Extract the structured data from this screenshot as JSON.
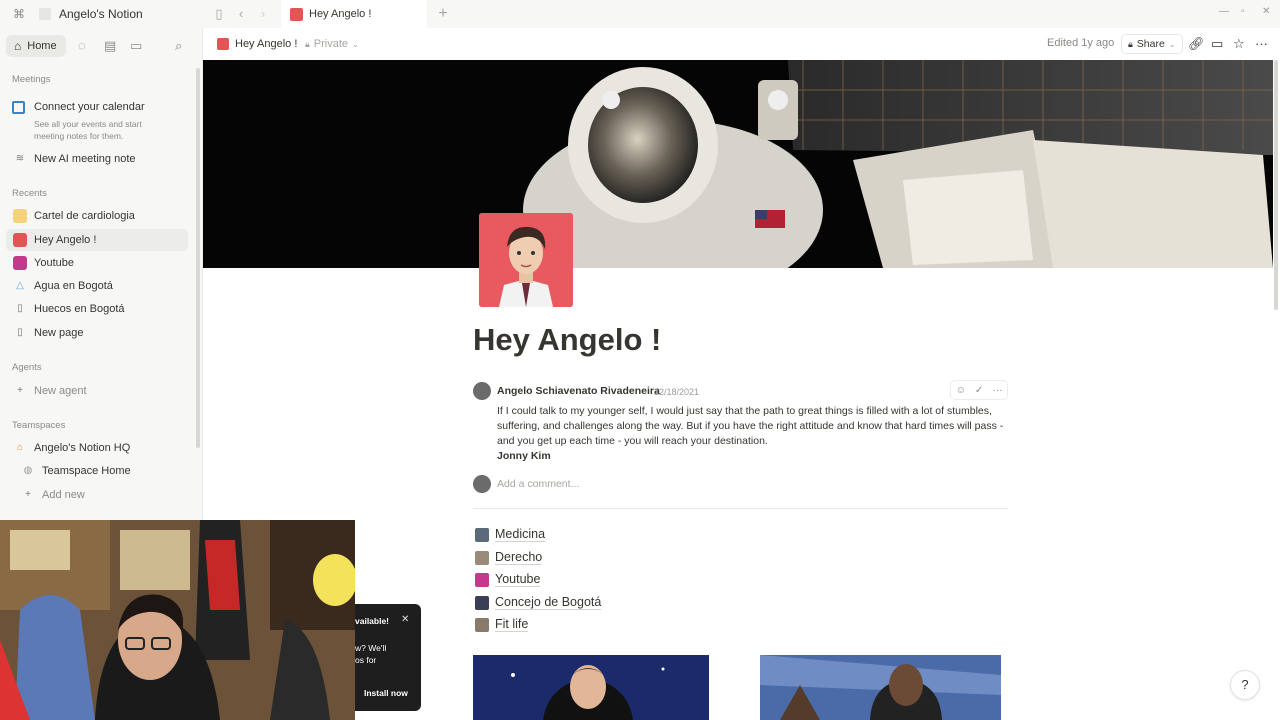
{
  "app": {
    "workspace_name": "Angelo's Notion",
    "tab_title": "Hey Angelo !"
  },
  "sidebar": {
    "home_label": "Home",
    "meetings_label": "Meetings",
    "calendar_title": "Connect your calendar",
    "calendar_desc": "See all your events and start meeting notes for them.",
    "ai_meeting": "New AI meeting note",
    "recents_label": "Recents",
    "recents": [
      {
        "label": "Cartel de cardiologia"
      },
      {
        "label": "Hey Angelo !"
      },
      {
        "label": "Youtube"
      },
      {
        "label": "Agua en Bogotá"
      },
      {
        "label": "Huecos en Bogotá"
      },
      {
        "label": "New page"
      }
    ],
    "agents_label": "Agents",
    "new_agent": "New agent",
    "teamspaces_label": "Teamspaces",
    "teamspace_name": "Angelo's Notion HQ",
    "teamspace_home": "Teamspace Home",
    "add_new": "Add new"
  },
  "topbar": {
    "breadcrumb": "Hey Angelo !",
    "privacy": "Private",
    "edited": "Edited 1y ago",
    "share": "Share"
  },
  "page": {
    "title": "Hey Angelo !",
    "comment": {
      "author": "Angelo Schiavenato Rivadeneira",
      "date": "12/18/2021",
      "body": "If I could talk to my younger self, I would just say that the path to great things is filled with a lot of stumbles, suffering, and challenges along the way. But if you have the right attitude and know that hard times will pass - and you get up each time - you will reach your destination.",
      "signature": "Jonny Kim"
    },
    "comment_placeholder": "Add a comment...",
    "links": [
      {
        "label": "Medicina"
      },
      {
        "label": "Derecho"
      },
      {
        "label": "Youtube"
      },
      {
        "label": "Concejo de Bogotá"
      },
      {
        "label": "Fit life"
      }
    ]
  },
  "toast": {
    "line1": "vailable!",
    "line2": "w? We'll",
    "line3": "os for",
    "install": "Install now"
  },
  "help": "?"
}
